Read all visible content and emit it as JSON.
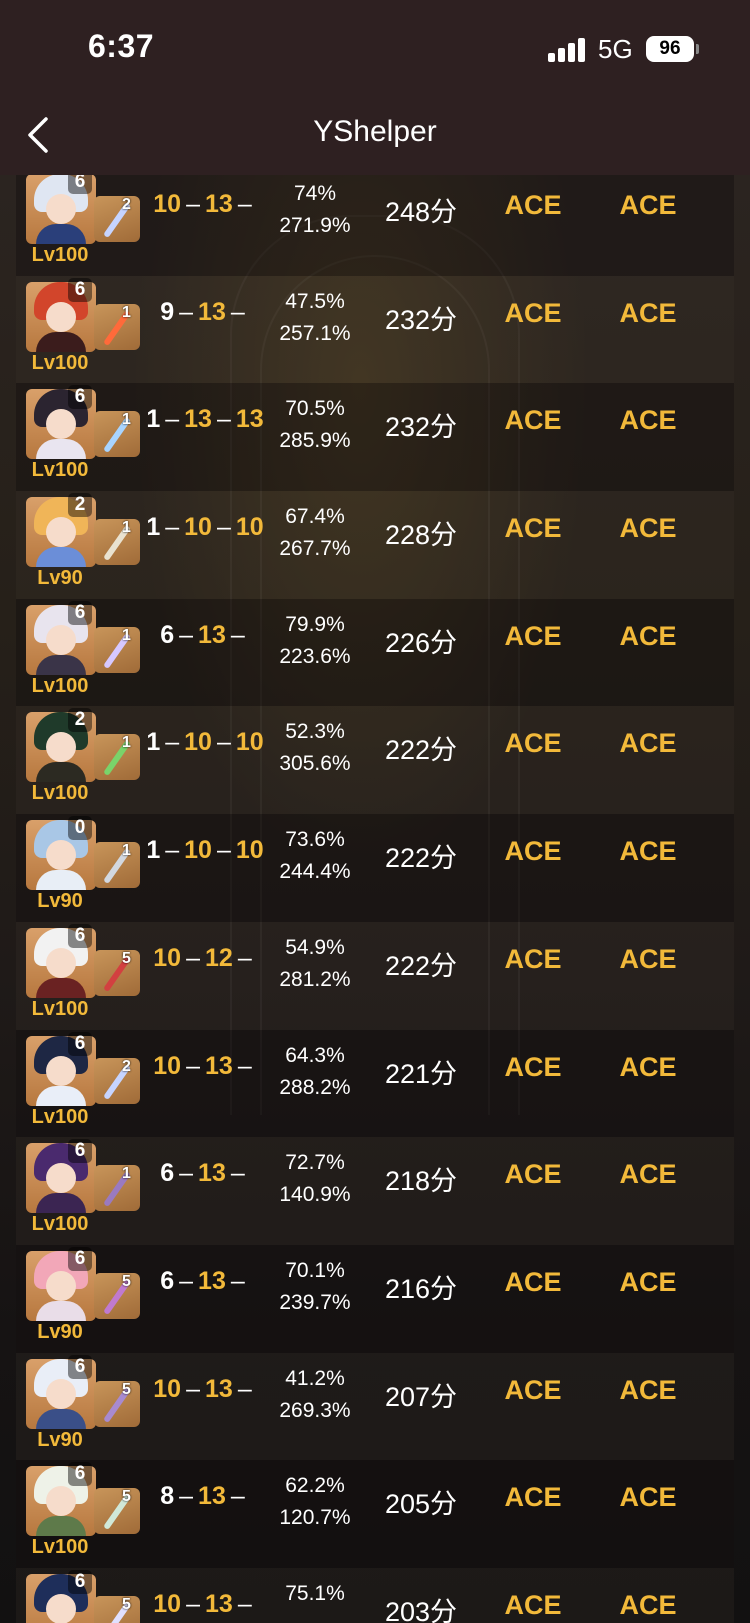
{
  "status": {
    "time": "6:37",
    "network": "5G",
    "battery": "96"
  },
  "nav": {
    "title": "YShelper"
  },
  "rows": [
    {
      "constellation": "6",
      "refine": "2",
      "level": "Lv100",
      "t1": "10",
      "t2": "13",
      "t3": "",
      "stat1": "74%",
      "stat2": "271.9%",
      "score": "248分",
      "grade1": "ACE",
      "grade2": "ACE"
    },
    {
      "constellation": "6",
      "refine": "1",
      "level": "Lv100",
      "t1": "9",
      "t2": "13",
      "t3": "",
      "stat1": "47.5%",
      "stat2": "257.1%",
      "score": "232分",
      "grade1": "ACE",
      "grade2": "ACE"
    },
    {
      "constellation": "6",
      "refine": "1",
      "level": "Lv100",
      "t1": "1",
      "t2": "13",
      "t3": "13",
      "stat1": "70.5%",
      "stat2": "285.9%",
      "score": "232分",
      "grade1": "ACE",
      "grade2": "ACE"
    },
    {
      "constellation": "2",
      "refine": "1",
      "level": "Lv90",
      "t1": "1",
      "t2": "10",
      "t3": "10",
      "stat1": "67.4%",
      "stat2": "267.7%",
      "score": "228分",
      "grade1": "ACE",
      "grade2": "ACE"
    },
    {
      "constellation": "6",
      "refine": "1",
      "level": "Lv100",
      "t1": "6",
      "t2": "13",
      "t3": "",
      "stat1": "79.9%",
      "stat2": "223.6%",
      "score": "226分",
      "grade1": "ACE",
      "grade2": "ACE"
    },
    {
      "constellation": "2",
      "refine": "1",
      "level": "Lv100",
      "t1": "1",
      "t2": "10",
      "t3": "10",
      "stat1": "52.3%",
      "stat2": "305.6%",
      "score": "222分",
      "grade1": "ACE",
      "grade2": "ACE"
    },
    {
      "constellation": "0",
      "refine": "1",
      "level": "Lv90",
      "t1": "1",
      "t2": "10",
      "t3": "10",
      "stat1": "73.6%",
      "stat2": "244.4%",
      "score": "222分",
      "grade1": "ACE",
      "grade2": "ACE"
    },
    {
      "constellation": "6",
      "refine": "5",
      "level": "Lv100",
      "t1": "10",
      "t2": "12",
      "t3": "",
      "stat1": "54.9%",
      "stat2": "281.2%",
      "score": "222分",
      "grade1": "ACE",
      "grade2": "ACE"
    },
    {
      "constellation": "6",
      "refine": "2",
      "level": "Lv100",
      "t1": "10",
      "t2": "13",
      "t3": "",
      "stat1": "64.3%",
      "stat2": "288.2%",
      "score": "221分",
      "grade1": "ACE",
      "grade2": "ACE"
    },
    {
      "constellation": "6",
      "refine": "1",
      "level": "Lv100",
      "t1": "6",
      "t2": "13",
      "t3": "",
      "stat1": "72.7%",
      "stat2": "140.9%",
      "score": "218分",
      "grade1": "ACE",
      "grade2": "ACE"
    },
    {
      "constellation": "6",
      "refine": "5",
      "level": "Lv90",
      "t1": "6",
      "t2": "13",
      "t3": "",
      "stat1": "70.1%",
      "stat2": "239.7%",
      "score": "216分",
      "grade1": "ACE",
      "grade2": "ACE"
    },
    {
      "constellation": "6",
      "refine": "5",
      "level": "Lv90",
      "t1": "10",
      "t2": "13",
      "t3": "",
      "stat1": "41.2%",
      "stat2": "269.3%",
      "score": "207分",
      "grade1": "ACE",
      "grade2": "ACE"
    },
    {
      "constellation": "6",
      "refine": "5",
      "level": "Lv100",
      "t1": "8",
      "t2": "13",
      "t3": "",
      "stat1": "62.2%",
      "stat2": "120.7%",
      "score": "205分",
      "grade1": "ACE",
      "grade2": "ACE"
    },
    {
      "constellation": "6",
      "refine": "5",
      "level": "",
      "t1": "10",
      "t2": "13",
      "t3": "",
      "stat1": "75.1%",
      "stat2": "",
      "score": "203分",
      "grade1": "ACE",
      "grade2": "ACE"
    }
  ],
  "colors": {
    "accent": "#f2b93a",
    "header_bg": "#2e2021"
  },
  "icons": {
    "back": "chevron-left-icon",
    "signal": "cellular-signal-icon",
    "battery": "battery-icon",
    "avatar": "character-avatar",
    "weapon": "weapon-icon"
  }
}
